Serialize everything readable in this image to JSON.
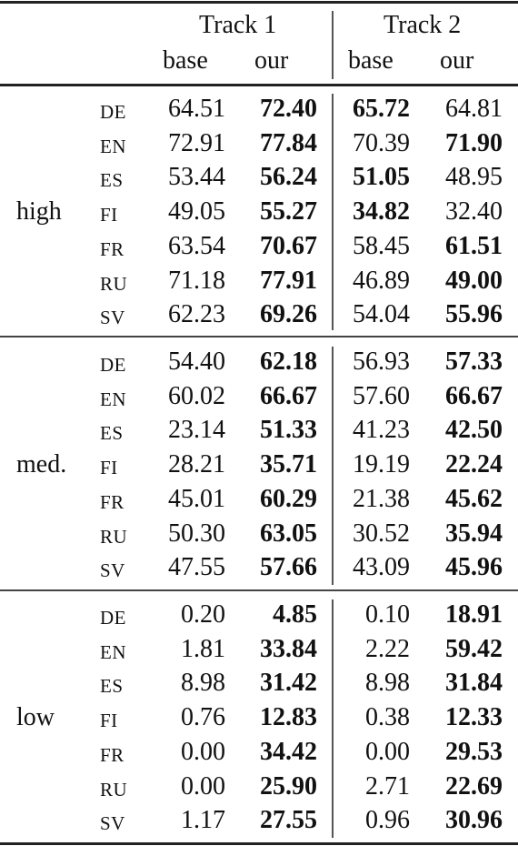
{
  "header": {
    "tracks": [
      {
        "label": "Track 1",
        "columns": [
          "base",
          "our"
        ]
      },
      {
        "label": "Track 2",
        "columns": [
          "base",
          "our"
        ]
      }
    ]
  },
  "groups": [
    {
      "label": "high",
      "rows": [
        {
          "lang": "DE",
          "t1_base": "64.51",
          "t1_our": "72.40",
          "t2_base": "65.72",
          "t2_our": "64.81",
          "bold": [
            "t1_our",
            "t2_base"
          ]
        },
        {
          "lang": "EN",
          "t1_base": "72.91",
          "t1_our": "77.84",
          "t2_base": "70.39",
          "t2_our": "71.90",
          "bold": [
            "t1_our",
            "t2_our"
          ]
        },
        {
          "lang": "ES",
          "t1_base": "53.44",
          "t1_our": "56.24",
          "t2_base": "51.05",
          "t2_our": "48.95",
          "bold": [
            "t1_our",
            "t2_base"
          ]
        },
        {
          "lang": "FI",
          "t1_base": "49.05",
          "t1_our": "55.27",
          "t2_base": "34.82",
          "t2_our": "32.40",
          "bold": [
            "t1_our",
            "t2_base"
          ]
        },
        {
          "lang": "FR",
          "t1_base": "63.54",
          "t1_our": "70.67",
          "t2_base": "58.45",
          "t2_our": "61.51",
          "bold": [
            "t1_our",
            "t2_our"
          ]
        },
        {
          "lang": "RU",
          "t1_base": "71.18",
          "t1_our": "77.91",
          "t2_base": "46.89",
          "t2_our": "49.00",
          "bold": [
            "t1_our",
            "t2_our"
          ]
        },
        {
          "lang": "SV",
          "t1_base": "62.23",
          "t1_our": "69.26",
          "t2_base": "54.04",
          "t2_our": "55.96",
          "bold": [
            "t1_our",
            "t2_our"
          ]
        }
      ]
    },
    {
      "label": "med.",
      "rows": [
        {
          "lang": "DE",
          "t1_base": "54.40",
          "t1_our": "62.18",
          "t2_base": "56.93",
          "t2_our": "57.33",
          "bold": [
            "t1_our",
            "t2_our"
          ]
        },
        {
          "lang": "EN",
          "t1_base": "60.02",
          "t1_our": "66.67",
          "t2_base": "57.60",
          "t2_our": "66.67",
          "bold": [
            "t1_our",
            "t2_our"
          ]
        },
        {
          "lang": "ES",
          "t1_base": "23.14",
          "t1_our": "51.33",
          "t2_base": "41.23",
          "t2_our": "42.50",
          "bold": [
            "t1_our",
            "t2_our"
          ]
        },
        {
          "lang": "FI",
          "t1_base": "28.21",
          "t1_our": "35.71",
          "t2_base": "19.19",
          "t2_our": "22.24",
          "bold": [
            "t1_our",
            "t2_our"
          ]
        },
        {
          "lang": "FR",
          "t1_base": "45.01",
          "t1_our": "60.29",
          "t2_base": "21.38",
          "t2_our": "45.62",
          "bold": [
            "t1_our",
            "t2_our"
          ]
        },
        {
          "lang": "RU",
          "t1_base": "50.30",
          "t1_our": "63.05",
          "t2_base": "30.52",
          "t2_our": "35.94",
          "bold": [
            "t1_our",
            "t2_our"
          ]
        },
        {
          "lang": "SV",
          "t1_base": "47.55",
          "t1_our": "57.66",
          "t2_base": "43.09",
          "t2_our": "45.96",
          "bold": [
            "t1_our",
            "t2_our"
          ]
        }
      ]
    },
    {
      "label": "low",
      "rows": [
        {
          "lang": "DE",
          "t1_base": "0.20",
          "t1_our": "4.85",
          "t2_base": "0.10",
          "t2_our": "18.91",
          "bold": [
            "t1_our",
            "t2_our"
          ]
        },
        {
          "lang": "EN",
          "t1_base": "1.81",
          "t1_our": "33.84",
          "t2_base": "2.22",
          "t2_our": "59.42",
          "bold": [
            "t1_our",
            "t2_our"
          ]
        },
        {
          "lang": "ES",
          "t1_base": "8.98",
          "t1_our": "31.42",
          "t2_base": "8.98",
          "t2_our": "31.84",
          "bold": [
            "t1_our",
            "t2_our"
          ]
        },
        {
          "lang": "FI",
          "t1_base": "0.76",
          "t1_our": "12.83",
          "t2_base": "0.38",
          "t2_our": "12.33",
          "bold": [
            "t1_our",
            "t2_our"
          ]
        },
        {
          "lang": "FR",
          "t1_base": "0.00",
          "t1_our": "34.42",
          "t2_base": "0.00",
          "t2_our": "29.53",
          "bold": [
            "t1_our",
            "t2_our"
          ]
        },
        {
          "lang": "RU",
          "t1_base": "0.00",
          "t1_our": "25.90",
          "t2_base": "2.71",
          "t2_our": "22.69",
          "bold": [
            "t1_our",
            "t2_our"
          ]
        },
        {
          "lang": "SV",
          "t1_base": "1.17",
          "t1_our": "27.55",
          "t2_base": "0.96",
          "t2_our": "30.96",
          "bold": [
            "t1_our",
            "t2_our"
          ]
        }
      ]
    }
  ]
}
